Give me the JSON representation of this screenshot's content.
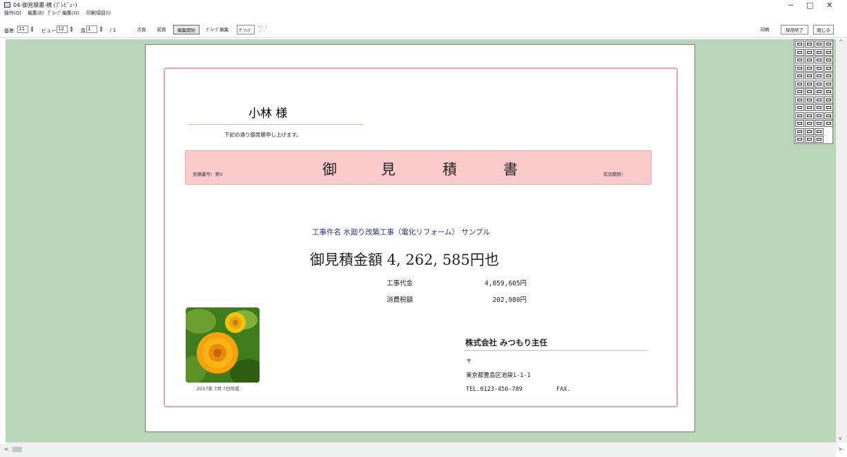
{
  "window": {
    "title": "04-御見積書-横 (ﾌﾟﾚﾋﾞｭｰ)",
    "controls": {
      "minimize": "−",
      "maximize": "□",
      "close": "✕"
    },
    "icon": "app-icon"
  },
  "menu": [
    "操作(Q)",
    "編集(E)",
    "ｸﾞﾙｰﾌﾟ編集(G)",
    "印刷項目(I)"
  ],
  "toolbar": {
    "base_label": "基準",
    "base_value": "11",
    "view_label": "ビュー",
    "view_value": "12",
    "page_label": "頁",
    "page_value": "1",
    "page_total": "/ 1",
    "buttons": [
      "次頁",
      "前頁",
      "編集開始",
      "ｸﾞﾙｰﾌﾟ編集",
      "ｸﾞﾘｯﾄﾞ",
      "ｶﾗｰ ｺﾋﾟｰ"
    ],
    "right_buttons": [
      "印刷",
      "保存終了",
      "閉じる"
    ]
  },
  "document": {
    "addressee": "小林 様",
    "greeting": "下記の通り御見積申し上げます。",
    "estimate_no": "見積番号：第0",
    "title_chars": [
      "御",
      "見",
      "積",
      "書"
    ],
    "valid_period": "有効期限：",
    "project": "工事件名  水廻り改築工事（電化リフォーム） サンプル",
    "total": "御見積金額   4, 262, 585円也",
    "rows": [
      {
        "label": "工事代金",
        "value": "4,059,605円"
      },
      {
        "label": "消費税額",
        "value": "202,980円"
      }
    ],
    "photo_date": "2017年 7月 7日作成",
    "company": "株式会社  みつもり主任",
    "postal": "〒",
    "address": "東京都豊島区池袋1-1-1",
    "tel": "TEL.0123-456-789",
    "fax": "FAX.",
    "colors": {
      "frame": "#e8a4a4",
      "band": "#fbcaca",
      "project": "#2f2f8f",
      "workspace": "#b9d6b9"
    }
  },
  "scroll": {
    "up": "^",
    "down": "v",
    "left": "<",
    "right": ">"
  }
}
